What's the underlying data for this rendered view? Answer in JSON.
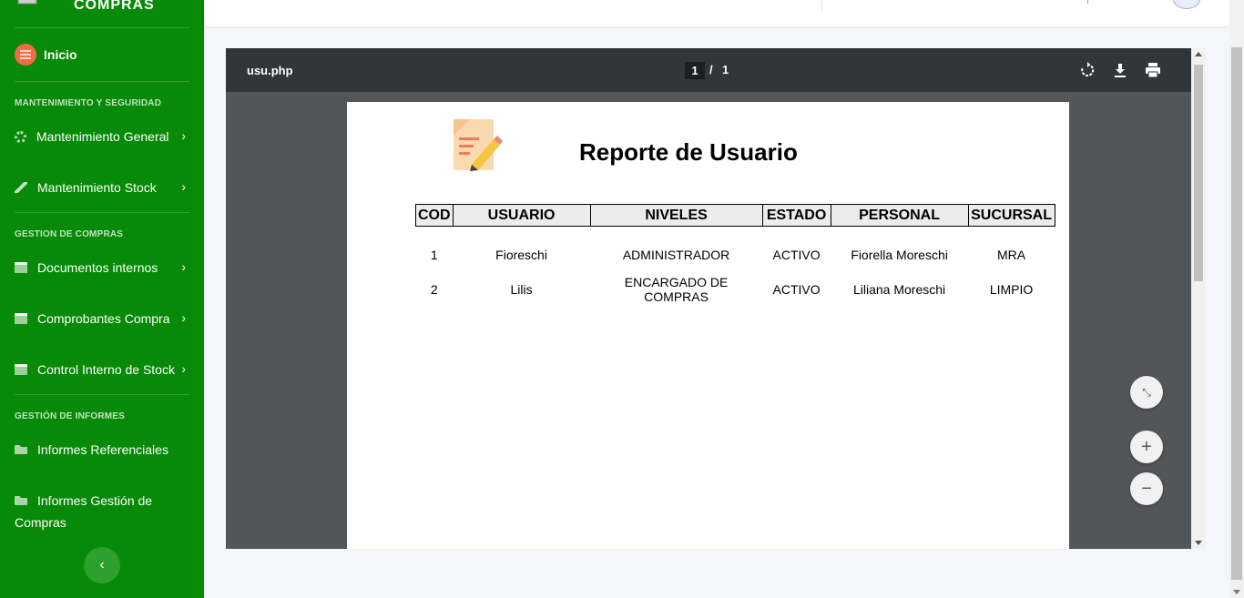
{
  "sidebar": {
    "brand": "COMPRAS",
    "home": {
      "icon": "list-icon",
      "label": "Inicio"
    },
    "sections": {
      "mantenimiento": "MANTENIMIENTO Y SEGURIDAD",
      "compras": "GESTION DE COMPRAS",
      "informes": "GESTIÓN DE INFORMES"
    },
    "items": {
      "mant_general": {
        "icon": "gear-icon",
        "label": "Mantenimiento General"
      },
      "mant_stock": {
        "icon": "wrench-icon",
        "label": "Mantenimiento Stock"
      },
      "docs_internos": {
        "icon": "archive-icon",
        "label": "Documentos internos"
      },
      "comprobantes": {
        "icon": "archive-icon",
        "label": "Comprobantes Compra"
      },
      "control_stock": {
        "icon": "archive-icon",
        "label": "Control Interno de Stock"
      },
      "inf_referenciales": {
        "icon": "folder-icon",
        "label": "Informes Referenciales"
      },
      "inf_gestion": {
        "icon": "folder-icon",
        "label": "Informes Gestión de Compras"
      }
    },
    "chevron": "›",
    "collapse": "‹"
  },
  "viewer": {
    "filename": "usu.php",
    "current_page": "1",
    "page_separator": "/",
    "total_pages": "1",
    "zoom_in": "+",
    "zoom_out": "−",
    "fit": "⤡"
  },
  "report": {
    "title": "Reporte de Usuario",
    "headers": [
      "COD",
      "USUARIO",
      "NIVELES",
      "ESTADO",
      "PERSONAL",
      "SUCURSAL"
    ],
    "rows": [
      [
        "1",
        "Fioreschi",
        "ADMINISTRADOR",
        "ACTIVO",
        "Fiorella Moreschi",
        "MRA"
      ],
      [
        "2",
        "Lilis",
        "ENCARGADO DE COMPRAS",
        "ACTIVO",
        "Liliana Moreschi",
        "LIMPIO"
      ]
    ]
  },
  "colors": {
    "sidebar_bg": "#078a07",
    "toolbar_bg": "#323639",
    "viewer_bg": "#525659"
  }
}
